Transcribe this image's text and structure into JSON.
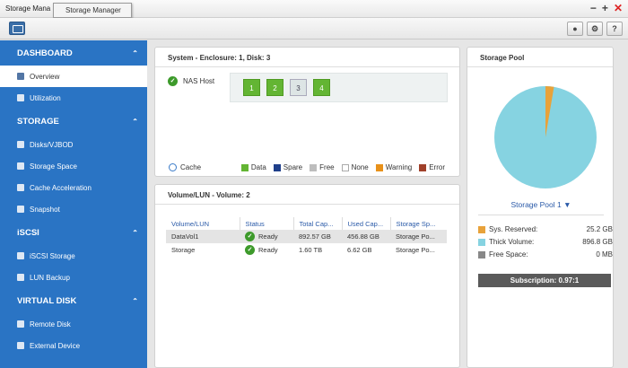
{
  "window": {
    "title": "Storage Mana",
    "tooltip": "Storage Manager"
  },
  "toolbar": {
    "btn1": "⚙",
    "btn2": "⚙",
    "help": "?"
  },
  "sidebar": {
    "dashboard": "DASHBOARD",
    "overview": "Overview",
    "utilization": "Utilization",
    "storage": "STORAGE",
    "disks": "Disks/VJBOD",
    "storage_space": "Storage Space",
    "cache_accel": "Cache Acceleration",
    "snapshot": "Snapshot",
    "iscsi": "iSCSI",
    "iscsi_storage": "iSCSI Storage",
    "lun_backup": "LUN Backup",
    "virtual_disk": "VIRTUAL DISK",
    "remote_disk": "Remote Disk",
    "external_device": "External Device"
  },
  "system": {
    "title": "System - Enclosure: 1, Disk: 3",
    "nas_host": "NAS Host",
    "disks": [
      {
        "label": "1",
        "state": "data"
      },
      {
        "label": "2",
        "state": "data"
      },
      {
        "label": "3",
        "state": "none"
      },
      {
        "label": "4",
        "state": "data"
      }
    ],
    "cache": "Cache",
    "legend": [
      {
        "label": "Data",
        "color": "#63b533"
      },
      {
        "label": "Spare",
        "color": "#1f3f8a"
      },
      {
        "label": "Free",
        "color": "#bdbdbd"
      },
      {
        "label": "None",
        "color": "#ffffff"
      },
      {
        "label": "Warning",
        "color": "#e8911a"
      },
      {
        "label": "Error",
        "color": "#a0402a"
      }
    ]
  },
  "volume": {
    "title": "Volume/LUN - Volume: 2",
    "columns": [
      "Volume/LUN",
      "Status",
      "Total Cap...",
      "Used Cap...",
      "Storage Sp..."
    ],
    "rows": [
      {
        "name": "DataVol1",
        "status": "Ready",
        "total": "892.57 GB",
        "used": "456.88 GB",
        "space": "Storage Po..."
      },
      {
        "name": "Storage",
        "status": "Ready",
        "total": "1.60 TB",
        "used": "6.62 GB",
        "space": "Storage Po..."
      }
    ]
  },
  "pool": {
    "title": "Storage Pool",
    "name": "Storage Pool 1",
    "stats": [
      {
        "label": "Sys. Reserved:",
        "value": "25.2 GB",
        "color": "#e8a23a"
      },
      {
        "label": "Thick Volume:",
        "value": "896.8 GB",
        "color": "#86d3e1"
      },
      {
        "label": "Free Space:",
        "value": "0 MB",
        "color": "#888888"
      }
    ],
    "subscription": "Subscription: 0.97:1"
  }
}
